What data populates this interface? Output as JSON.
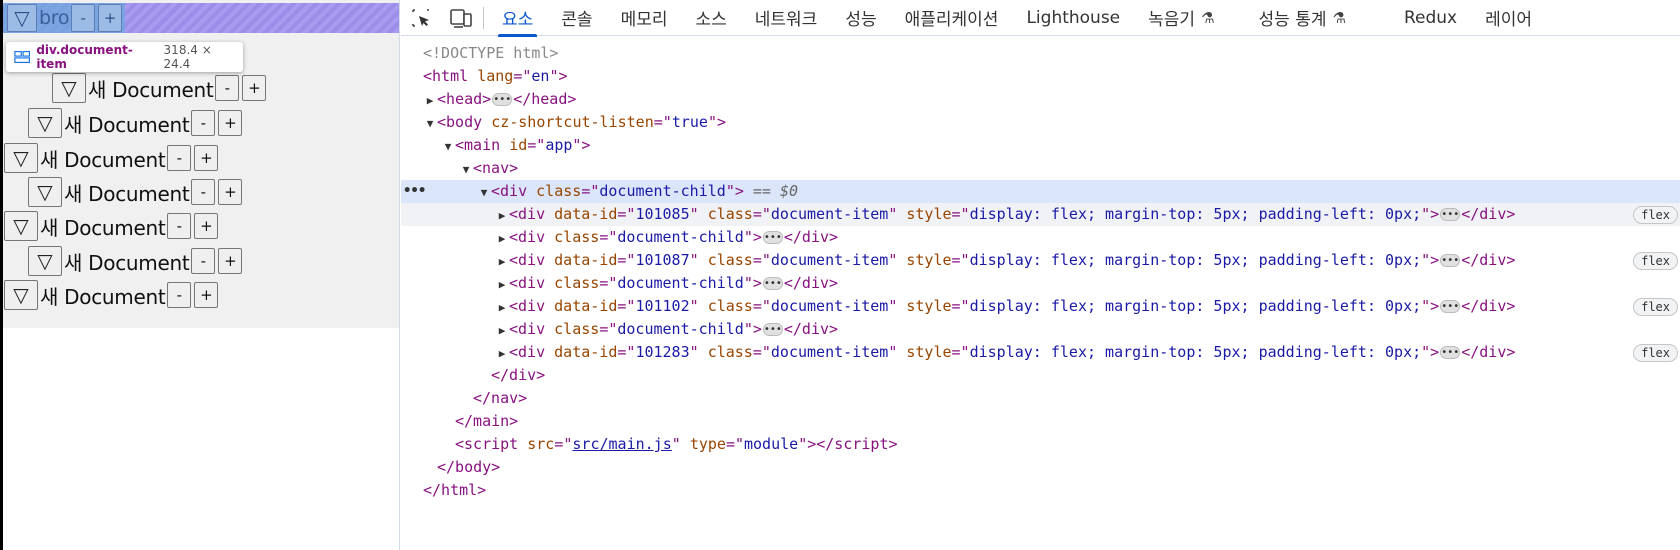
{
  "app": {
    "highlighted_row": {
      "label": "bro",
      "minus": "-",
      "plus": "+",
      "toggle": "▽"
    },
    "tooltip": {
      "tag": "div.document-item",
      "size": "318.4 × 24.4"
    },
    "rows": [
      {
        "label": "새 Document",
        "toggle": "▽",
        "minus": "-",
        "plus": "+"
      },
      {
        "label": "새 Document",
        "toggle": "▽",
        "minus": "-",
        "plus": "+"
      },
      {
        "label": "새 Document",
        "toggle": "▽",
        "minus": "-",
        "plus": "+"
      },
      {
        "label": "새 Document",
        "toggle": "▽",
        "minus": "-",
        "plus": "+"
      },
      {
        "label": "새 Document",
        "toggle": "▽",
        "minus": "-",
        "plus": "+"
      },
      {
        "label": "새 Document",
        "toggle": "▽",
        "minus": "-",
        "plus": "+"
      },
      {
        "label": "새 Document",
        "toggle": "▽",
        "minus": "-",
        "plus": "+"
      }
    ]
  },
  "devtools": {
    "tabs": [
      {
        "label": "요소"
      },
      {
        "label": "콘솔"
      },
      {
        "label": "메모리"
      },
      {
        "label": "소스"
      },
      {
        "label": "네트워크"
      },
      {
        "label": "성능"
      },
      {
        "label": "애플리케이션"
      },
      {
        "label": "Lighthouse"
      },
      {
        "label": "녹음기"
      },
      {
        "label": "성능 통계"
      },
      {
        "label": "Redux"
      },
      {
        "label": "레이어"
      }
    ],
    "active_tab": "요소",
    "accent": "#0b57d0",
    "selected_marker": "== $0",
    "badge": "flex",
    "doctype": "<!DOCTYPE html>",
    "html_lang": "en",
    "body_attr_name": "cz-shortcut-listen",
    "body_attr_value": "true",
    "main_id": "app",
    "class_document_child": "document-child",
    "class_document_item": "document-item",
    "item_style": "display: flex; margin-top: 5px; padding-left: 0px;",
    "item_ids": [
      "101085",
      "101087",
      "101102",
      "101283"
    ],
    "script_src": "src/main.js",
    "script_type": "module"
  }
}
